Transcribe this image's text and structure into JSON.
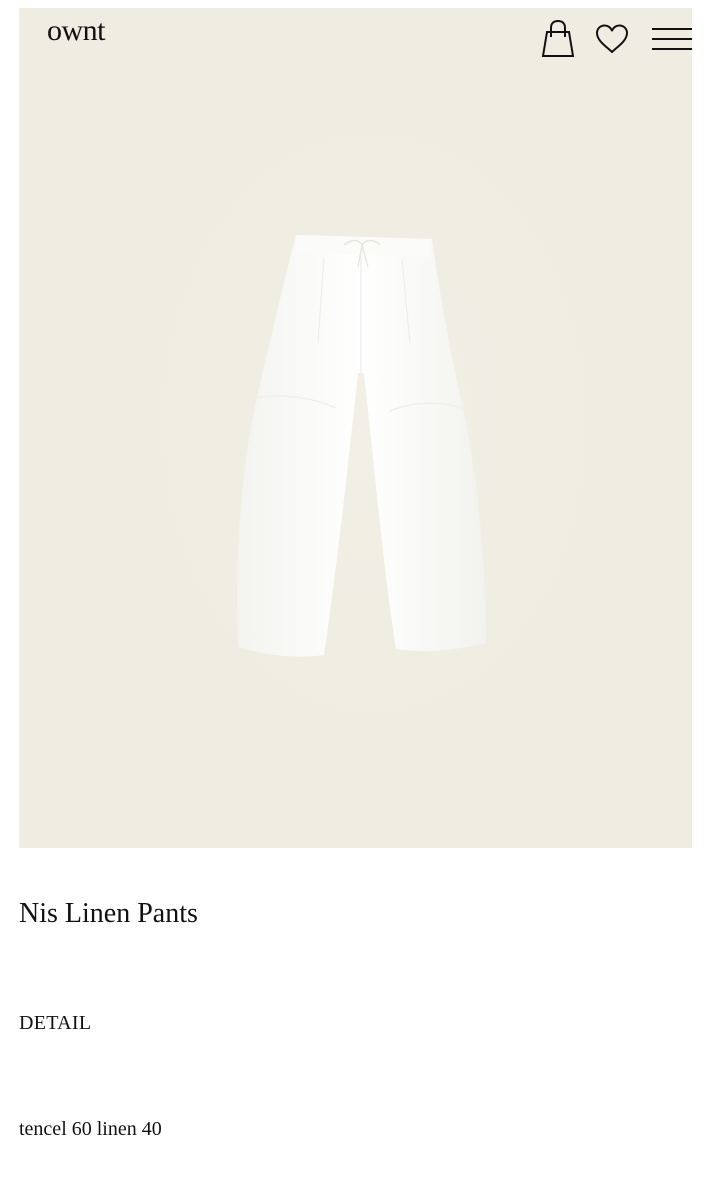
{
  "header": {
    "logo_text": "ownt",
    "icons": [
      "shopping-bag-icon",
      "heart-icon",
      "hamburger-menu-icon"
    ]
  },
  "hero": {
    "background_color": "#efede1",
    "image_subject": "white pants"
  },
  "product": {
    "name": "Nis Linen Pants"
  },
  "detail": {
    "heading": "DETAIL",
    "composition": "tencel 60 linen 40"
  }
}
